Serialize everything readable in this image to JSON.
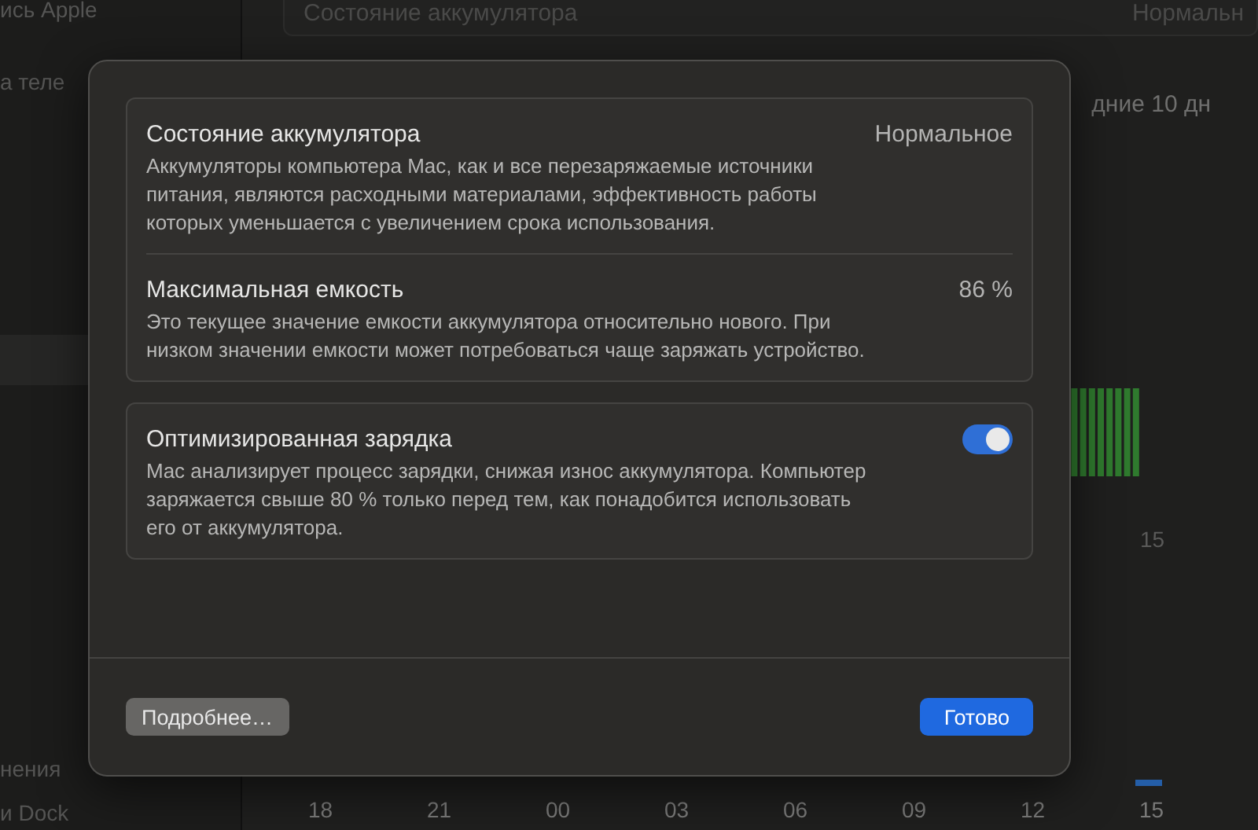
{
  "sidebar": {
    "items": [
      {
        "label": "ись Apple"
      },
      {
        "label": "а теле"
      },
      {
        "label": "нения"
      },
      {
        "label": "и Dock"
      }
    ]
  },
  "background": {
    "status_title": "Состояние аккумулятора",
    "status_value": "Нормальн",
    "range_label": "дние 10 дн",
    "chart_label": "15",
    "axis_labels": [
      "18",
      "21",
      "00",
      "03",
      "06",
      "09",
      "12",
      "15"
    ]
  },
  "dialog": {
    "groups": [
      {
        "rows": [
          {
            "title": "Состояние аккумулятора",
            "value": "Нормальное",
            "description": "Аккумуляторы компьютера Mac, как и все перезаряжаемые источники питания, являются расходными материалами, эффективность работы которых уменьшается с увеличением срока использования."
          },
          {
            "title": "Максимальная емкость",
            "value": "86 %",
            "description": "Это текущее значение емкости аккумулятора относительно нового. При низком значении емкости может потребоваться чаще заряжать устройство."
          }
        ]
      },
      {
        "rows": [
          {
            "title": "Оптимизированная зарядка",
            "toggle": {
              "on": true
            },
            "description": "Mac анализирует процесс зарядки, снижая износ аккумулятора. Компьютер заряжается свыше 80 % только перед тем, как понадобится использовать его от аккумулятора."
          }
        ]
      }
    ],
    "buttons": [
      {
        "label": "Подробнее…",
        "kind": "secondary"
      },
      {
        "label": "Готово",
        "kind": "primary"
      }
    ]
  }
}
